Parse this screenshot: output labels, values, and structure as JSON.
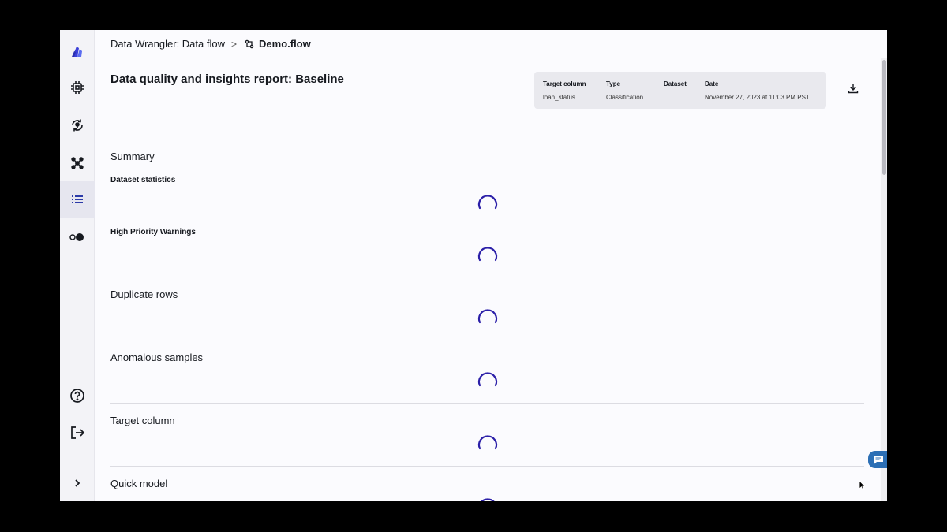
{
  "breadcrumb": {
    "parent": "Data Wrangler: Data flow",
    "separator": ">",
    "flow_name": "Demo.flow"
  },
  "sidebar": {
    "items": [
      {
        "name": "logo",
        "icon": "data-wrangler-logo-icon"
      },
      {
        "name": "chip",
        "icon": "chip-icon"
      },
      {
        "name": "pipeline",
        "icon": "refresh-pin-icon"
      },
      {
        "name": "nodes",
        "icon": "network-icon"
      },
      {
        "name": "list",
        "icon": "list-icon",
        "active": true
      },
      {
        "name": "toggle",
        "icon": "toggle-dots-icon"
      },
      {
        "name": "help",
        "icon": "help-icon"
      },
      {
        "name": "signout",
        "icon": "sign-out-icon"
      },
      {
        "name": "expand",
        "icon": "chevron-right-icon"
      }
    ]
  },
  "report": {
    "title": "Data quality and insights report: Baseline",
    "meta": {
      "target_column_label": "Target column",
      "target_column_value": "loan_status",
      "type_label": "Type",
      "type_value": "Classification",
      "dataset_label": "Dataset",
      "dataset_value": "",
      "date_label": "Date",
      "date_value": "November 27, 2023 at 11:03 PM PST"
    },
    "summary_title": "Summary",
    "dataset_statistics": "Dataset statistics",
    "high_priority_warnings": "High Priority Warnings",
    "sections": [
      "Duplicate rows",
      "Anomalous samples",
      "Target column",
      "Quick model"
    ]
  },
  "colors": {
    "spinner": "#2b1fa8",
    "accent": "#2c6fb5",
    "logo": "#3b3fd8"
  }
}
